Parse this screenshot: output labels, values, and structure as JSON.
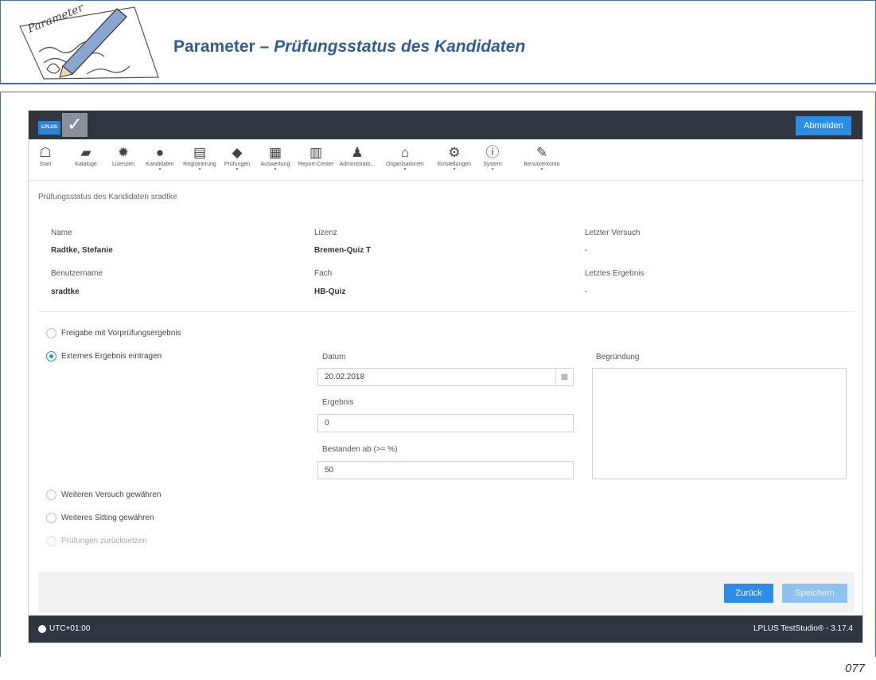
{
  "doc": {
    "logo_text": "Parameter",
    "title_main": "Parameter",
    "title_sep": " – ",
    "title_sub": "Prüfungsstatus des Kandidaten",
    "page_number": "077"
  },
  "app": {
    "brand_text": "LPLUS",
    "logout_label": "Abmelden",
    "nav": [
      {
        "label": "Start",
        "icon": "home-icon",
        "glyph": "☖",
        "caret": false
      },
      {
        "label": "Kataloge",
        "icon": "book-icon",
        "glyph": "▰",
        "caret": false
      },
      {
        "label": "Lizenzen",
        "icon": "certificate-icon",
        "glyph": "✹",
        "caret": false
      },
      {
        "label": "Kandidaten",
        "icon": "user-icon",
        "glyph": "●",
        "caret": true
      },
      {
        "label": "Registrierung",
        "icon": "id-card-icon",
        "glyph": "▤",
        "caret": true
      },
      {
        "label": "Prüfungen",
        "icon": "graduation-cap-icon",
        "glyph": "◆",
        "caret": true
      },
      {
        "label": "Auswertung",
        "icon": "table-icon",
        "glyph": "▦",
        "caret": true
      },
      {
        "label": "Report-Center",
        "icon": "bar-chart-icon",
        "glyph": "▥",
        "caret": false
      },
      {
        "label": "Administrato...",
        "icon": "admin-icon",
        "glyph": "♟",
        "caret": false
      },
      {
        "label": "Organisationen",
        "icon": "bank-icon",
        "glyph": "⌂",
        "caret": true
      },
      {
        "label": "Einstellungen",
        "icon": "cogs-icon",
        "glyph": "⚙",
        "caret": true
      },
      {
        "label": "System",
        "icon": "info-icon",
        "glyph": "ⓘ",
        "caret": true
      },
      {
        "label": "Benutzerkonto",
        "icon": "wrench-icon",
        "glyph": "✎",
        "caret": true
      }
    ],
    "breadcrumb": "Prüfungsstatus des Kandidaten sradtke",
    "info": {
      "name_label": "Name",
      "name_value": "Radtke, Stefanie",
      "license_label": "Lizenz",
      "license_value": "Bremen-Quiz T",
      "last_try_label": "Letzter Versuch",
      "last_try_value": "-",
      "username_label": "Benutzername",
      "username_value": "sradtke",
      "subject_label": "Fach",
      "subject_value": "HB-Quiz",
      "last_result_label": "Letztes Ergebnis",
      "last_result_value": "-"
    },
    "options": {
      "release": "Freigabe mit Vorprüfungsergebnis",
      "external": "Externes Ergebnis eintragen",
      "another_try": "Weiteren Versuch gewähren",
      "another_sitting": "Weiteres Sitting gewähren",
      "reset": "Prüfungen zurücksetzen",
      "selected": "external"
    },
    "form": {
      "date_label": "Datum",
      "date_value": "20.02.2018",
      "result_label": "Ergebnis",
      "result_value": "0",
      "passed_label": "Bestanden ab (>= %)",
      "passed_value": "50",
      "reason_label": "Begründung",
      "reason_value": ""
    },
    "back_label": "Zurück",
    "save_label": "Speichern",
    "timezone": "UTC+01:00",
    "version": "LPLUS TestStudio® - 3.17.4"
  }
}
